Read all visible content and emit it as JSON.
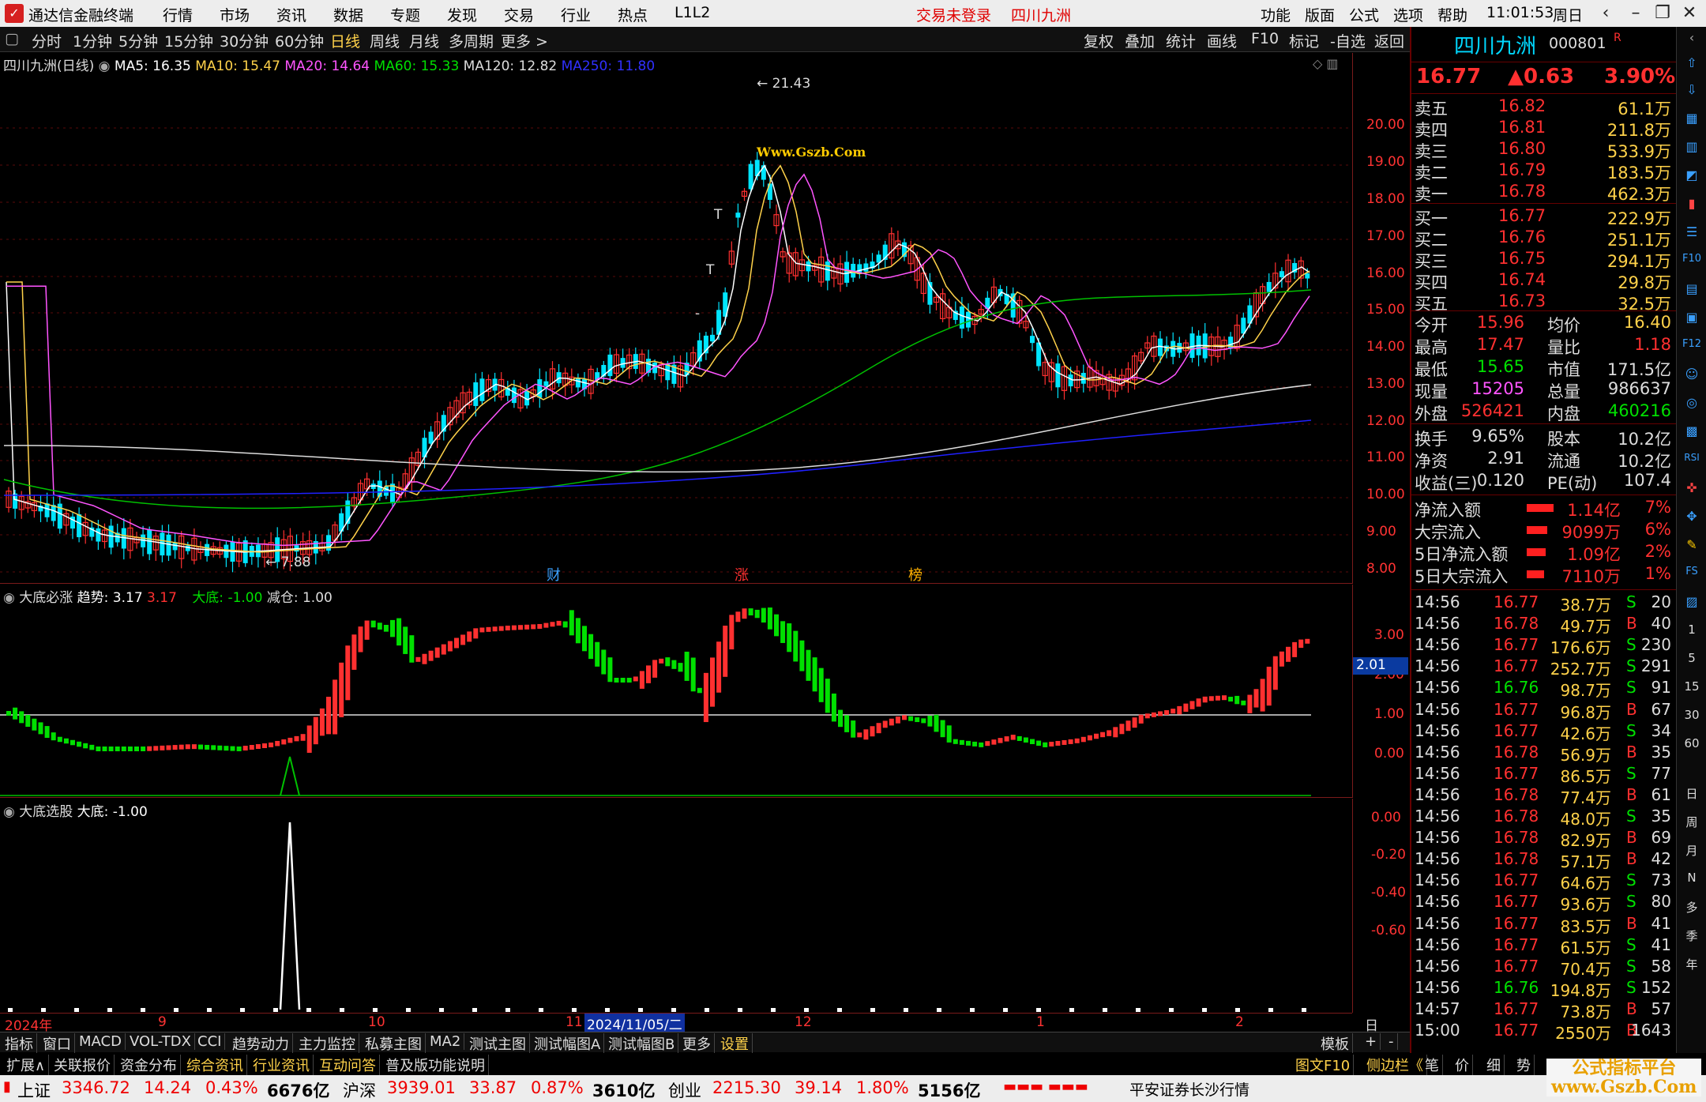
{
  "titlebar": {
    "app_title": "通达信金融终端",
    "menus": [
      "行情",
      "市场",
      "资讯",
      "数据",
      "专题",
      "发现",
      "交易",
      "行业",
      "热点",
      "L1L2"
    ],
    "login_status": "交易未登录",
    "stock_name": "四川九洲",
    "right_menus": [
      "功能",
      "版面",
      "公式",
      "选项",
      "帮助"
    ],
    "clock": "11:01:53",
    "weekday": "周日"
  },
  "periodbar": {
    "items": [
      "分时",
      "1分钟",
      "5分钟",
      "15分钟",
      "30分钟",
      "60分钟",
      "日线",
      "周线",
      "月线",
      "多周期",
      "更多 >"
    ],
    "active": "日线",
    "right_items": [
      "复权",
      "叠加",
      "统计",
      "画线",
      "F10",
      "标记",
      "-自选",
      "返回"
    ]
  },
  "main": {
    "title": "四川九洲(日线)",
    "ma": [
      {
        "label": "MA5: 16.35",
        "color": "#ffffff"
      },
      {
        "label": "MA10: 15.47",
        "color": "#ffd24a"
      },
      {
        "label": "MA20: 14.64",
        "color": "#ff55ff"
      },
      {
        "label": "MA60: 15.33",
        "color": "#00e000"
      },
      {
        "label": "MA120: 12.82",
        "color": "#dddddd"
      },
      {
        "label": "MA250: 11.80",
        "color": "#3030ff"
      }
    ],
    "yticks": [
      "20.00",
      "19.00",
      "18.00",
      "17.00",
      "16.00",
      "15.00",
      "14.00",
      "13.00",
      "12.00",
      "11.00",
      "10.00",
      "9.00",
      "8.00"
    ],
    "high_label": "21.43",
    "low_label": "7.88",
    "markers": [
      "财",
      "涨",
      "榜"
    ],
    "watermark": "Www.Gszb.Com"
  },
  "ind1": {
    "title": "大底必涨",
    "trend": "趋势: 3.17",
    "trend_val": "3.17",
    "dadi": "大底: -1.00",
    "jiancang": "减仓: 1.00",
    "yticks": [
      "3.00",
      "2.00",
      "1.00",
      "0.00"
    ],
    "current": "2.01"
  },
  "ind2": {
    "title": "大底选股",
    "dadi": "大底: -1.00",
    "yticks": [
      "0.00",
      "-0.20",
      "-0.40",
      "-0.60"
    ]
  },
  "dates": [
    "2024年",
    "9",
    "10",
    "11",
    "2024/11/05/二",
    "12",
    "1",
    "2"
  ],
  "rpanel": {
    "name": "四川九洲",
    "code": "000801",
    "price": "16.77",
    "change": "▲0.63",
    "pct": "3.90%",
    "asks": [
      [
        "卖五",
        "16.82",
        "61.1万"
      ],
      [
        "卖四",
        "16.81",
        "211.8万"
      ],
      [
        "卖三",
        "16.80",
        "533.9万"
      ],
      [
        "卖二",
        "16.79",
        "183.5万"
      ],
      [
        "卖一",
        "16.78",
        "462.3万"
      ]
    ],
    "bids": [
      [
        "买一",
        "16.77",
        "222.9万"
      ],
      [
        "买二",
        "16.76",
        "251.1万"
      ],
      [
        "买三",
        "16.75",
        "294.1万"
      ],
      [
        "买四",
        "16.74",
        "29.8万"
      ],
      [
        "买五",
        "16.73",
        "32.5万"
      ]
    ],
    "stats": [
      [
        "今开",
        "15.96",
        "均价",
        "16.40"
      ],
      [
        "最高",
        "17.47",
        "量比",
        "1.18"
      ],
      [
        "最低",
        "15.65",
        "市值",
        "171.5亿"
      ],
      [
        "现量",
        "15205",
        "总量",
        "986637"
      ],
      [
        "外盘",
        "526421",
        "内盘",
        "460216"
      ]
    ],
    "stats2": [
      [
        "换手",
        "9.65%",
        "股本",
        "10.2亿"
      ],
      [
        "净资",
        "2.91",
        "流通",
        "10.2亿"
      ],
      [
        "收益(三)",
        "0.120",
        "PE(动)",
        "107.4"
      ]
    ],
    "flows": [
      [
        "净流入额",
        "1.14亿",
        "7%"
      ],
      [
        "大宗流入",
        "9099万",
        "6%"
      ],
      [
        "5日净流入额",
        "1.09亿",
        "2%"
      ],
      [
        "5日大宗流入",
        "7110万",
        "1%"
      ]
    ],
    "ticks": [
      [
        "14:56",
        "16.77",
        "38.7万",
        "S",
        "20"
      ],
      [
        "14:56",
        "16.78",
        "49.7万",
        "B",
        "40"
      ],
      [
        "14:56",
        "16.77",
        "176.6万",
        "S",
        "230"
      ],
      [
        "14:56",
        "16.77",
        "252.7万",
        "S",
        "291"
      ],
      [
        "14:56",
        "16.76",
        "98.7万",
        "S",
        "91"
      ],
      [
        "14:56",
        "16.77",
        "96.8万",
        "B",
        "67"
      ],
      [
        "14:56",
        "16.77",
        "42.6万",
        "S",
        "34"
      ],
      [
        "14:56",
        "16.78",
        "56.9万",
        "B",
        "35"
      ],
      [
        "14:56",
        "16.77",
        "86.5万",
        "S",
        "77"
      ],
      [
        "14:56",
        "16.78",
        "77.4万",
        "B",
        "61"
      ],
      [
        "14:56",
        "16.78",
        "48.0万",
        "S",
        "35"
      ],
      [
        "14:56",
        "16.78",
        "82.9万",
        "B",
        "69"
      ],
      [
        "14:56",
        "16.78",
        "57.1万",
        "B",
        "42"
      ],
      [
        "14:56",
        "16.77",
        "64.6万",
        "S",
        "73"
      ],
      [
        "14:56",
        "16.77",
        "93.6万",
        "S",
        "80"
      ],
      [
        "14:56",
        "16.77",
        "83.5万",
        "B",
        "41"
      ],
      [
        "14:56",
        "16.77",
        "61.5万",
        "S",
        "41"
      ],
      [
        "14:56",
        "16.77",
        "70.4万",
        "S",
        "58"
      ],
      [
        "14:56",
        "16.76",
        "194.8万",
        "S",
        "152"
      ],
      [
        "14:57",
        "16.77",
        "73.8万",
        "B",
        "57"
      ],
      [
        "15:00",
        "16.77",
        "2550万",
        "B",
        "1643"
      ]
    ]
  },
  "tabs": [
    "指标",
    "窗口",
    "MACD",
    "VOL-TDX",
    "CCI",
    "趋势动力",
    "主力监控",
    "私募主图",
    "MA2",
    "测试主图",
    "测试幅图A",
    "测试幅图B",
    "更多",
    "设置"
  ],
  "tabs_right": [
    "模板",
    "+",
    "-"
  ],
  "date_label_right": "日线",
  "tabs2": [
    "扩展∧",
    "关联报价",
    "资金分布",
    "综合资讯",
    "行业资讯",
    "互动问答",
    "普及版功能说明"
  ],
  "tabs2_right": [
    "图文F10",
    "侧边栏《",
    "笔",
    "价",
    "细",
    "势"
  ],
  "status": {
    "sh": [
      "上证",
      "3346.72",
      "14.24",
      "0.43%",
      "6676亿"
    ],
    "sz": [
      "沪深",
      "3939.01",
      "33.87",
      "0.87%",
      "3610亿"
    ],
    "cy": [
      "创业",
      "2215.30",
      "39.14",
      "1.80%",
      "5156亿"
    ],
    "broker": "平安证券长沙行情"
  },
  "watermark2": "公式指标平台\nwww.Gszb.Com"
}
